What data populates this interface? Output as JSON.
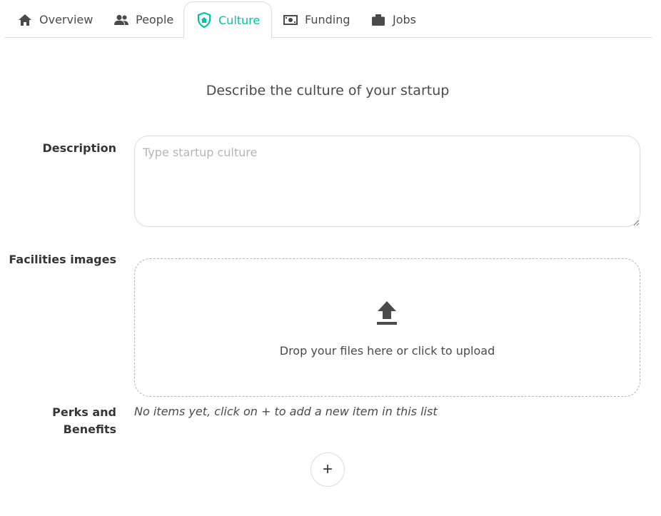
{
  "tabs": [
    {
      "label": "Overview",
      "icon": "home-icon"
    },
    {
      "label": "People",
      "icon": "people-icon"
    },
    {
      "label": "Culture",
      "icon": "culture-shield-icon",
      "active": true
    },
    {
      "label": "Funding",
      "icon": "money-icon"
    },
    {
      "label": "Jobs",
      "icon": "briefcase-icon"
    }
  ],
  "subtitle": "Describe the culture of your startup",
  "form": {
    "description_label": "Description",
    "description_placeholder": "Type startup culture",
    "description_value": "",
    "facilities_label": "Facilities images",
    "dropzone_text": "Drop your files here or click to upload",
    "perks_label_line1": "Perks and",
    "perks_label_line2": "Benefits",
    "perks_empty_text": "No items yet, click on + to add a new item in this list",
    "add_button_label": "+"
  },
  "colors": {
    "accent": "#00c4a7",
    "text": "#363636",
    "border": "#dbdbdb"
  }
}
